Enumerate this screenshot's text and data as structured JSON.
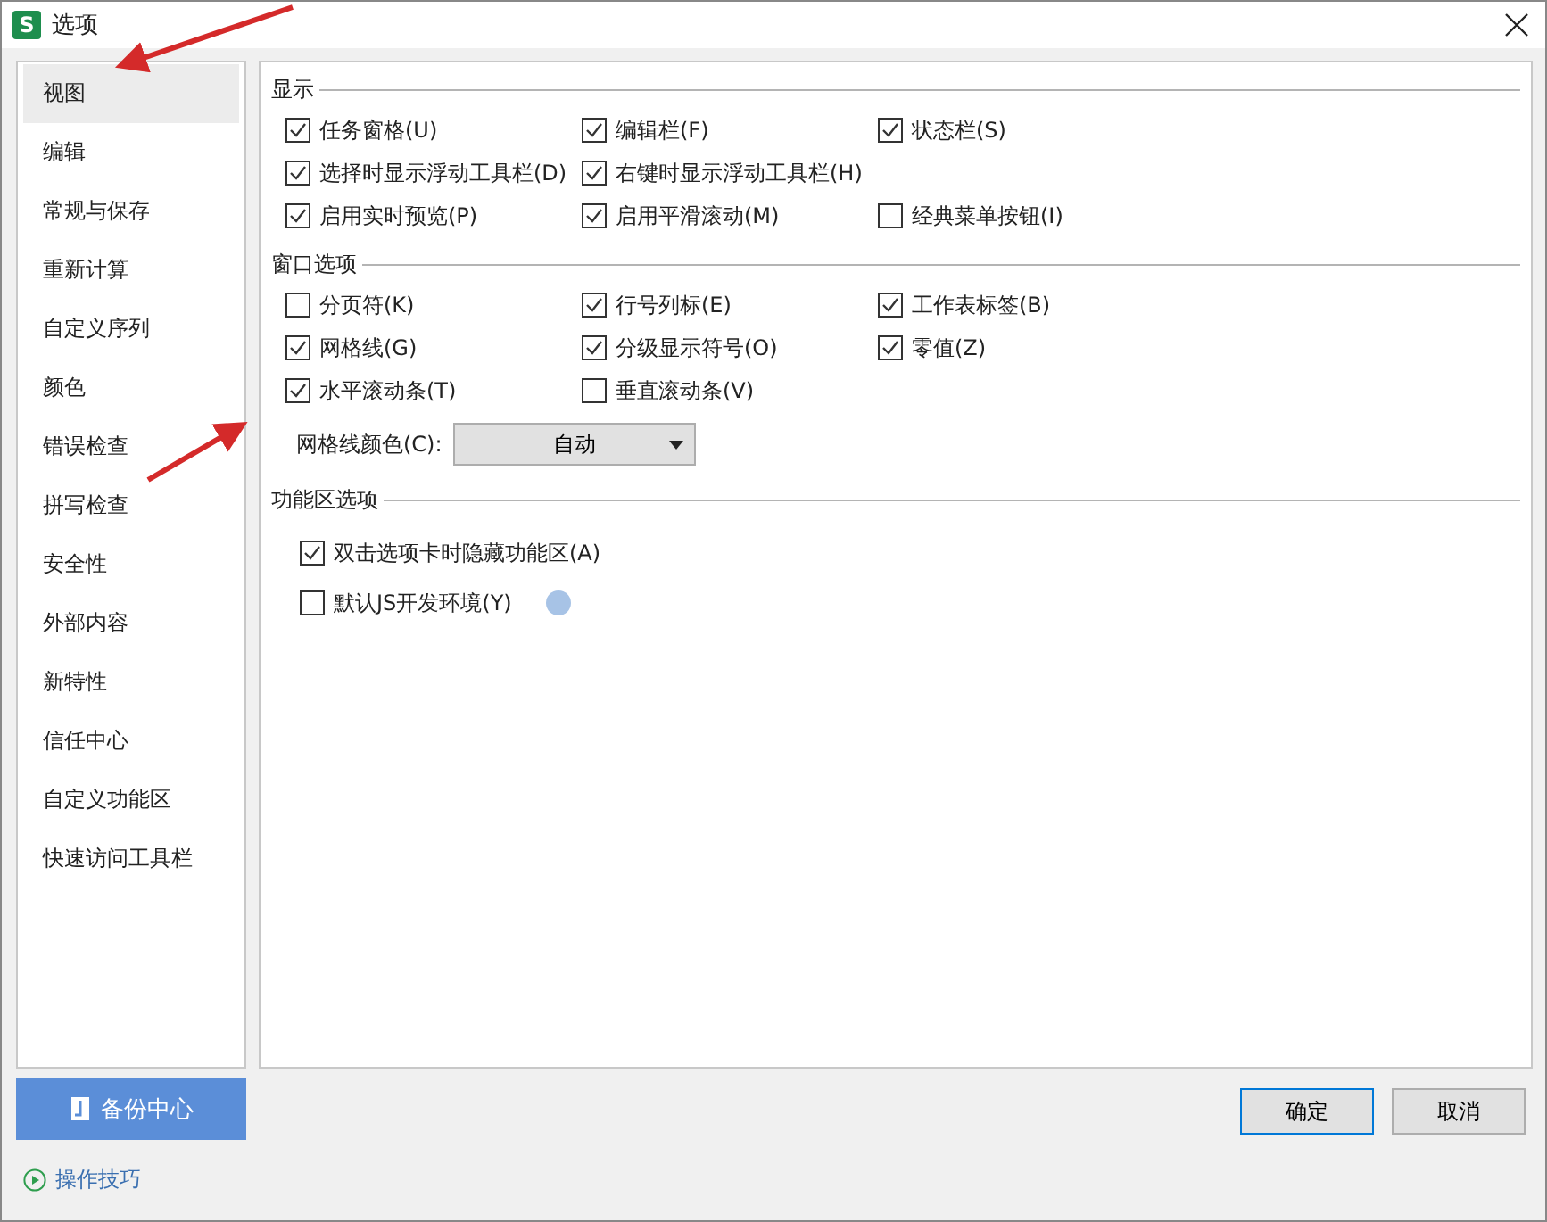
{
  "window": {
    "title": "选项",
    "app_badge": "S"
  },
  "sidebar": {
    "items": [
      {
        "label": "视图",
        "selected": true
      },
      {
        "label": "编辑",
        "selected": false
      },
      {
        "label": "常规与保存",
        "selected": false
      },
      {
        "label": "重新计算",
        "selected": false
      },
      {
        "label": "自定义序列",
        "selected": false
      },
      {
        "label": "颜色",
        "selected": false
      },
      {
        "label": "错误检查",
        "selected": false
      },
      {
        "label": "拼写检查",
        "selected": false
      },
      {
        "label": "安全性",
        "selected": false
      },
      {
        "label": "外部内容",
        "selected": false
      },
      {
        "label": "新特性",
        "selected": false
      },
      {
        "label": "信任中心",
        "selected": false
      },
      {
        "label": "自定义功能区",
        "selected": false
      },
      {
        "label": "快速访问工具栏",
        "selected": false
      }
    ],
    "backup_button": "备份中心",
    "tips_link": "操作技巧"
  },
  "sections": [
    {
      "title": "显示",
      "kind": "grid",
      "rows": [
        [
          {
            "label": "任务窗格(U)",
            "checked": true
          },
          {
            "label": "编辑栏(F)",
            "checked": true
          },
          {
            "label": "状态栏(S)",
            "checked": true
          }
        ],
        [
          {
            "label": "选择时显示浮动工具栏(D)",
            "checked": true
          },
          {
            "label": "右键时显示浮动工具栏(H)",
            "checked": true
          }
        ],
        [
          {
            "label": "启用实时预览(P)",
            "checked": true
          },
          {
            "label": "启用平滑滚动(M)",
            "checked": true
          },
          {
            "label": "经典菜单按钮(I)",
            "checked": false
          }
        ]
      ]
    },
    {
      "title": "窗口选项",
      "kind": "grid",
      "rows": [
        [
          {
            "label": "分页符(K)",
            "checked": false
          },
          {
            "label": "行号列标(E)",
            "checked": true
          },
          {
            "label": "工作表标签(B)",
            "checked": true
          }
        ],
        [
          {
            "label": "网格线(G)",
            "checked": true
          },
          {
            "label": "分级显示符号(O)",
            "checked": true
          },
          {
            "label": "零值(Z)",
            "checked": true
          }
        ],
        [
          {
            "label": "水平滚动条(T)",
            "checked": true
          },
          {
            "label": "垂直滚动条(V)",
            "checked": false
          }
        ]
      ],
      "color_field": {
        "label": "网格线颜色(C):",
        "value": "自动"
      }
    },
    {
      "title": "功能区选项",
      "kind": "list",
      "rows": [
        [
          {
            "label": "双击选项卡时隐藏功能区(A)",
            "checked": true
          }
        ],
        [
          {
            "label": "默认JS开发环境(Y)",
            "checked": false,
            "help": true
          }
        ]
      ]
    }
  ],
  "buttons": [
    "确定",
    "取消"
  ]
}
